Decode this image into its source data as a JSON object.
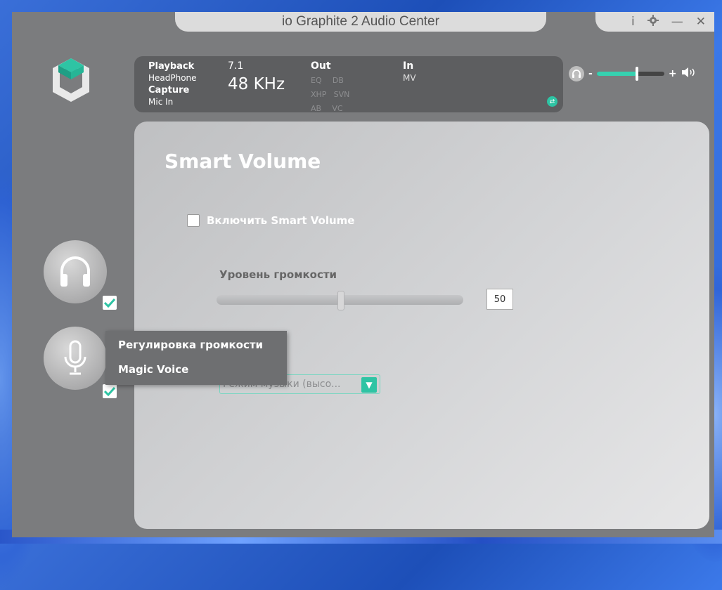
{
  "window": {
    "title": "io Graphite 2 Audio Center",
    "controls": {
      "info": "i",
      "minimize": "—",
      "close": "✕"
    }
  },
  "info_panel": {
    "playback_label": "Playback",
    "playback_device": "HeadPhone",
    "capture_label": "Capture",
    "capture_device": "Mic In",
    "channels": "7.1",
    "sample_rate": "48 KHz",
    "out_label": "Out",
    "out_effects": [
      "EQ",
      "DB",
      "XHP",
      "SVN",
      "AB",
      "VC"
    ],
    "in_label": "In",
    "in_effects": [
      "MV"
    ]
  },
  "master_volume": {
    "minus": "-",
    "plus": "+",
    "level": 0.6
  },
  "main": {
    "title": "Smart Volume",
    "enable_label": "Включить Smart Volume",
    "enable_checked": false,
    "volume_label": "Уровень громкости",
    "volume_value": "50",
    "volume_fraction": 0.5,
    "mode_value": "Режим музыки (высо..."
  },
  "nav": [
    {
      "name": "headphone",
      "checked": true
    },
    {
      "name": "microphone",
      "checked": true
    }
  ],
  "context_menu": {
    "items": [
      "Регулировка громкости",
      "Magic Voice"
    ]
  },
  "colors": {
    "accent": "#2ec4a4",
    "panel": "#5d5e60",
    "frame": "#7b7c7e"
  }
}
